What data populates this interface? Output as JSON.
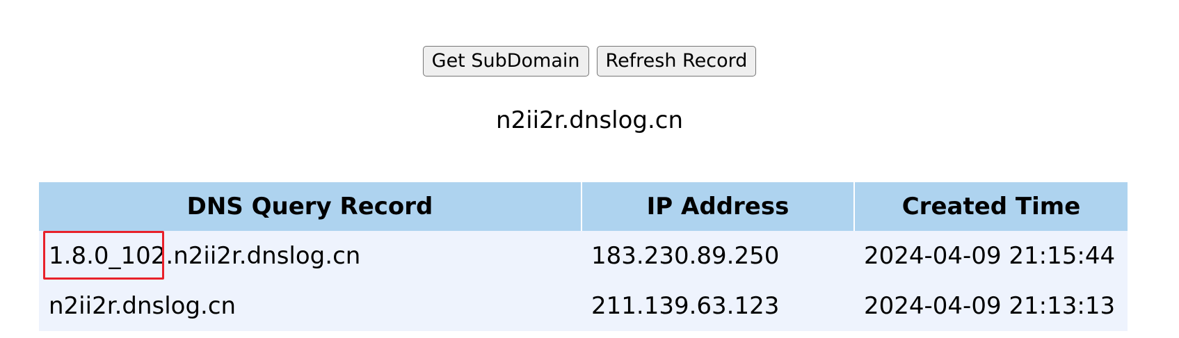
{
  "toolbar": {
    "get_subdomain_label": "Get SubDomain",
    "refresh_record_label": "Refresh Record"
  },
  "subdomain": "n2ii2r.dnslog.cn",
  "table": {
    "headers": [
      "DNS Query Record",
      "IP Address",
      "Created Time"
    ],
    "rows": [
      {
        "record": "1.8.0_102.n2ii2r.dnslog.cn",
        "ip": "183.230.89.250",
        "time": "2024-04-09 21:15:44"
      },
      {
        "record": "n2ii2r.dnslog.cn",
        "ip": "211.139.63.123",
        "time": "2024-04-09 21:13:13"
      }
    ]
  },
  "colors": {
    "header_bg": "#aed3ef",
    "row_bg": "#eef3fd",
    "highlight_border": "#e8212a"
  }
}
